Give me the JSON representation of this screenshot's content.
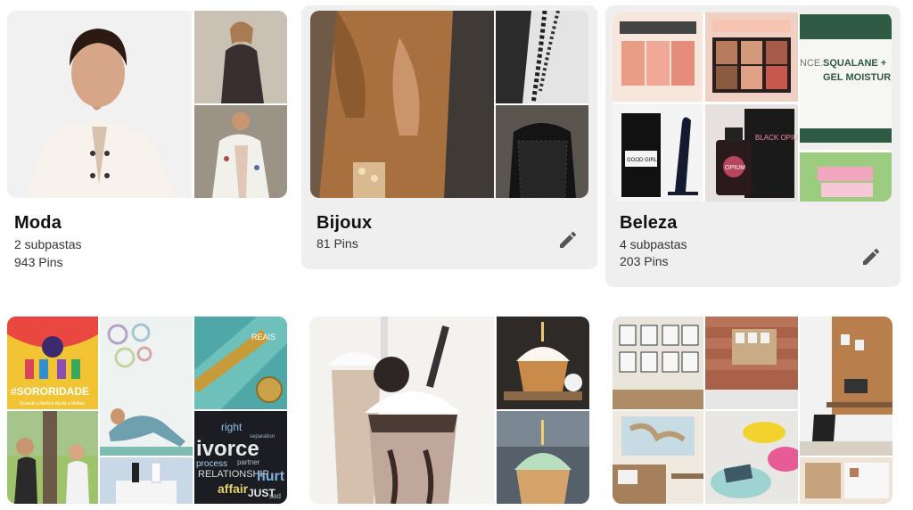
{
  "boards": [
    {
      "id": "moda",
      "title": "Moda",
      "subfolders": "2 subpastas",
      "pins": "943 Pins"
    },
    {
      "id": "bijoux",
      "title": "Bijoux",
      "pins": "81 Pins"
    },
    {
      "id": "beleza",
      "title": "Beleza",
      "subfolders": "4 subpastas",
      "pins": "203 Pins"
    }
  ],
  "image_text": {
    "sororidade": "#SORORIDADE",
    "sororidade_sub": "Quando a Mulher Ajuda a Mulher",
    "reais": "REAIS",
    "divorce": "ivorce",
    "relationship": "RELATIONSHIP",
    "process": "process",
    "affair": "affair",
    "just": "JUST",
    "hurt": "hurt",
    "right": "right",
    "partner": "partner",
    "separation": "separation",
    "sad": "sad",
    "squalane": "SQUALANE +",
    "gel": "GEL MOISTUR",
    "nce": "NCE.",
    "good_girl": "GOOD GIRL",
    "opium": "OPIUM",
    "black_opium": "BLACK OPIUM"
  },
  "icons": {
    "edit": "pencil-icon"
  }
}
